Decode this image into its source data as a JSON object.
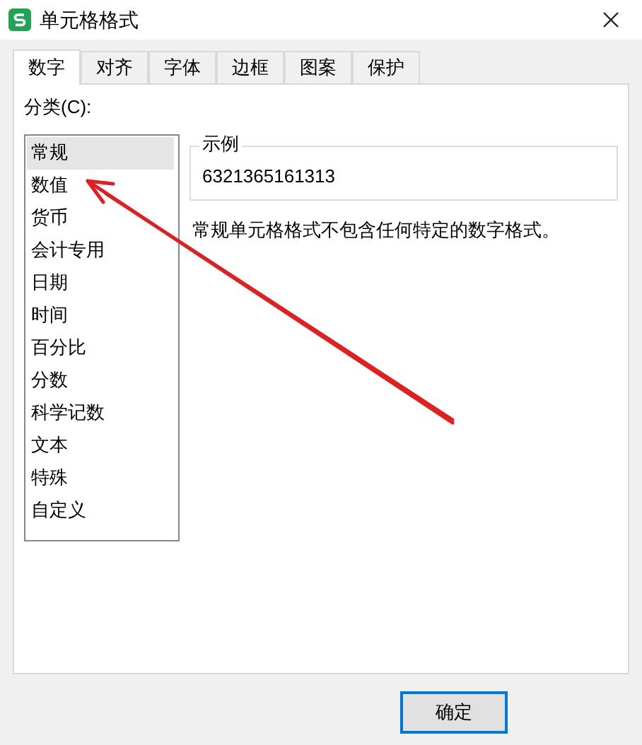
{
  "window": {
    "title": "单元格格式"
  },
  "tabs": [
    {
      "label": "数字",
      "selected": true
    },
    {
      "label": "对齐",
      "selected": false
    },
    {
      "label": "字体",
      "selected": false
    },
    {
      "label": "边框",
      "selected": false
    },
    {
      "label": "图案",
      "selected": false
    },
    {
      "label": "保护",
      "selected": false
    }
  ],
  "category": {
    "label": "分类(C):",
    "items": [
      {
        "label": "常规",
        "selected": true
      },
      {
        "label": "数值",
        "selected": false
      },
      {
        "label": "货币",
        "selected": false
      },
      {
        "label": "会计专用",
        "selected": false
      },
      {
        "label": "日期",
        "selected": false
      },
      {
        "label": "时间",
        "selected": false
      },
      {
        "label": "百分比",
        "selected": false
      },
      {
        "label": "分数",
        "selected": false
      },
      {
        "label": "科学记数",
        "selected": false
      },
      {
        "label": "文本",
        "selected": false
      },
      {
        "label": "特殊",
        "selected": false
      },
      {
        "label": "自定义",
        "selected": false
      }
    ]
  },
  "sample": {
    "label": "示例",
    "value": "6321365161313"
  },
  "description": "常规单元格格式不包含任何特定的数字格式。",
  "buttons": [
    "确定"
  ]
}
